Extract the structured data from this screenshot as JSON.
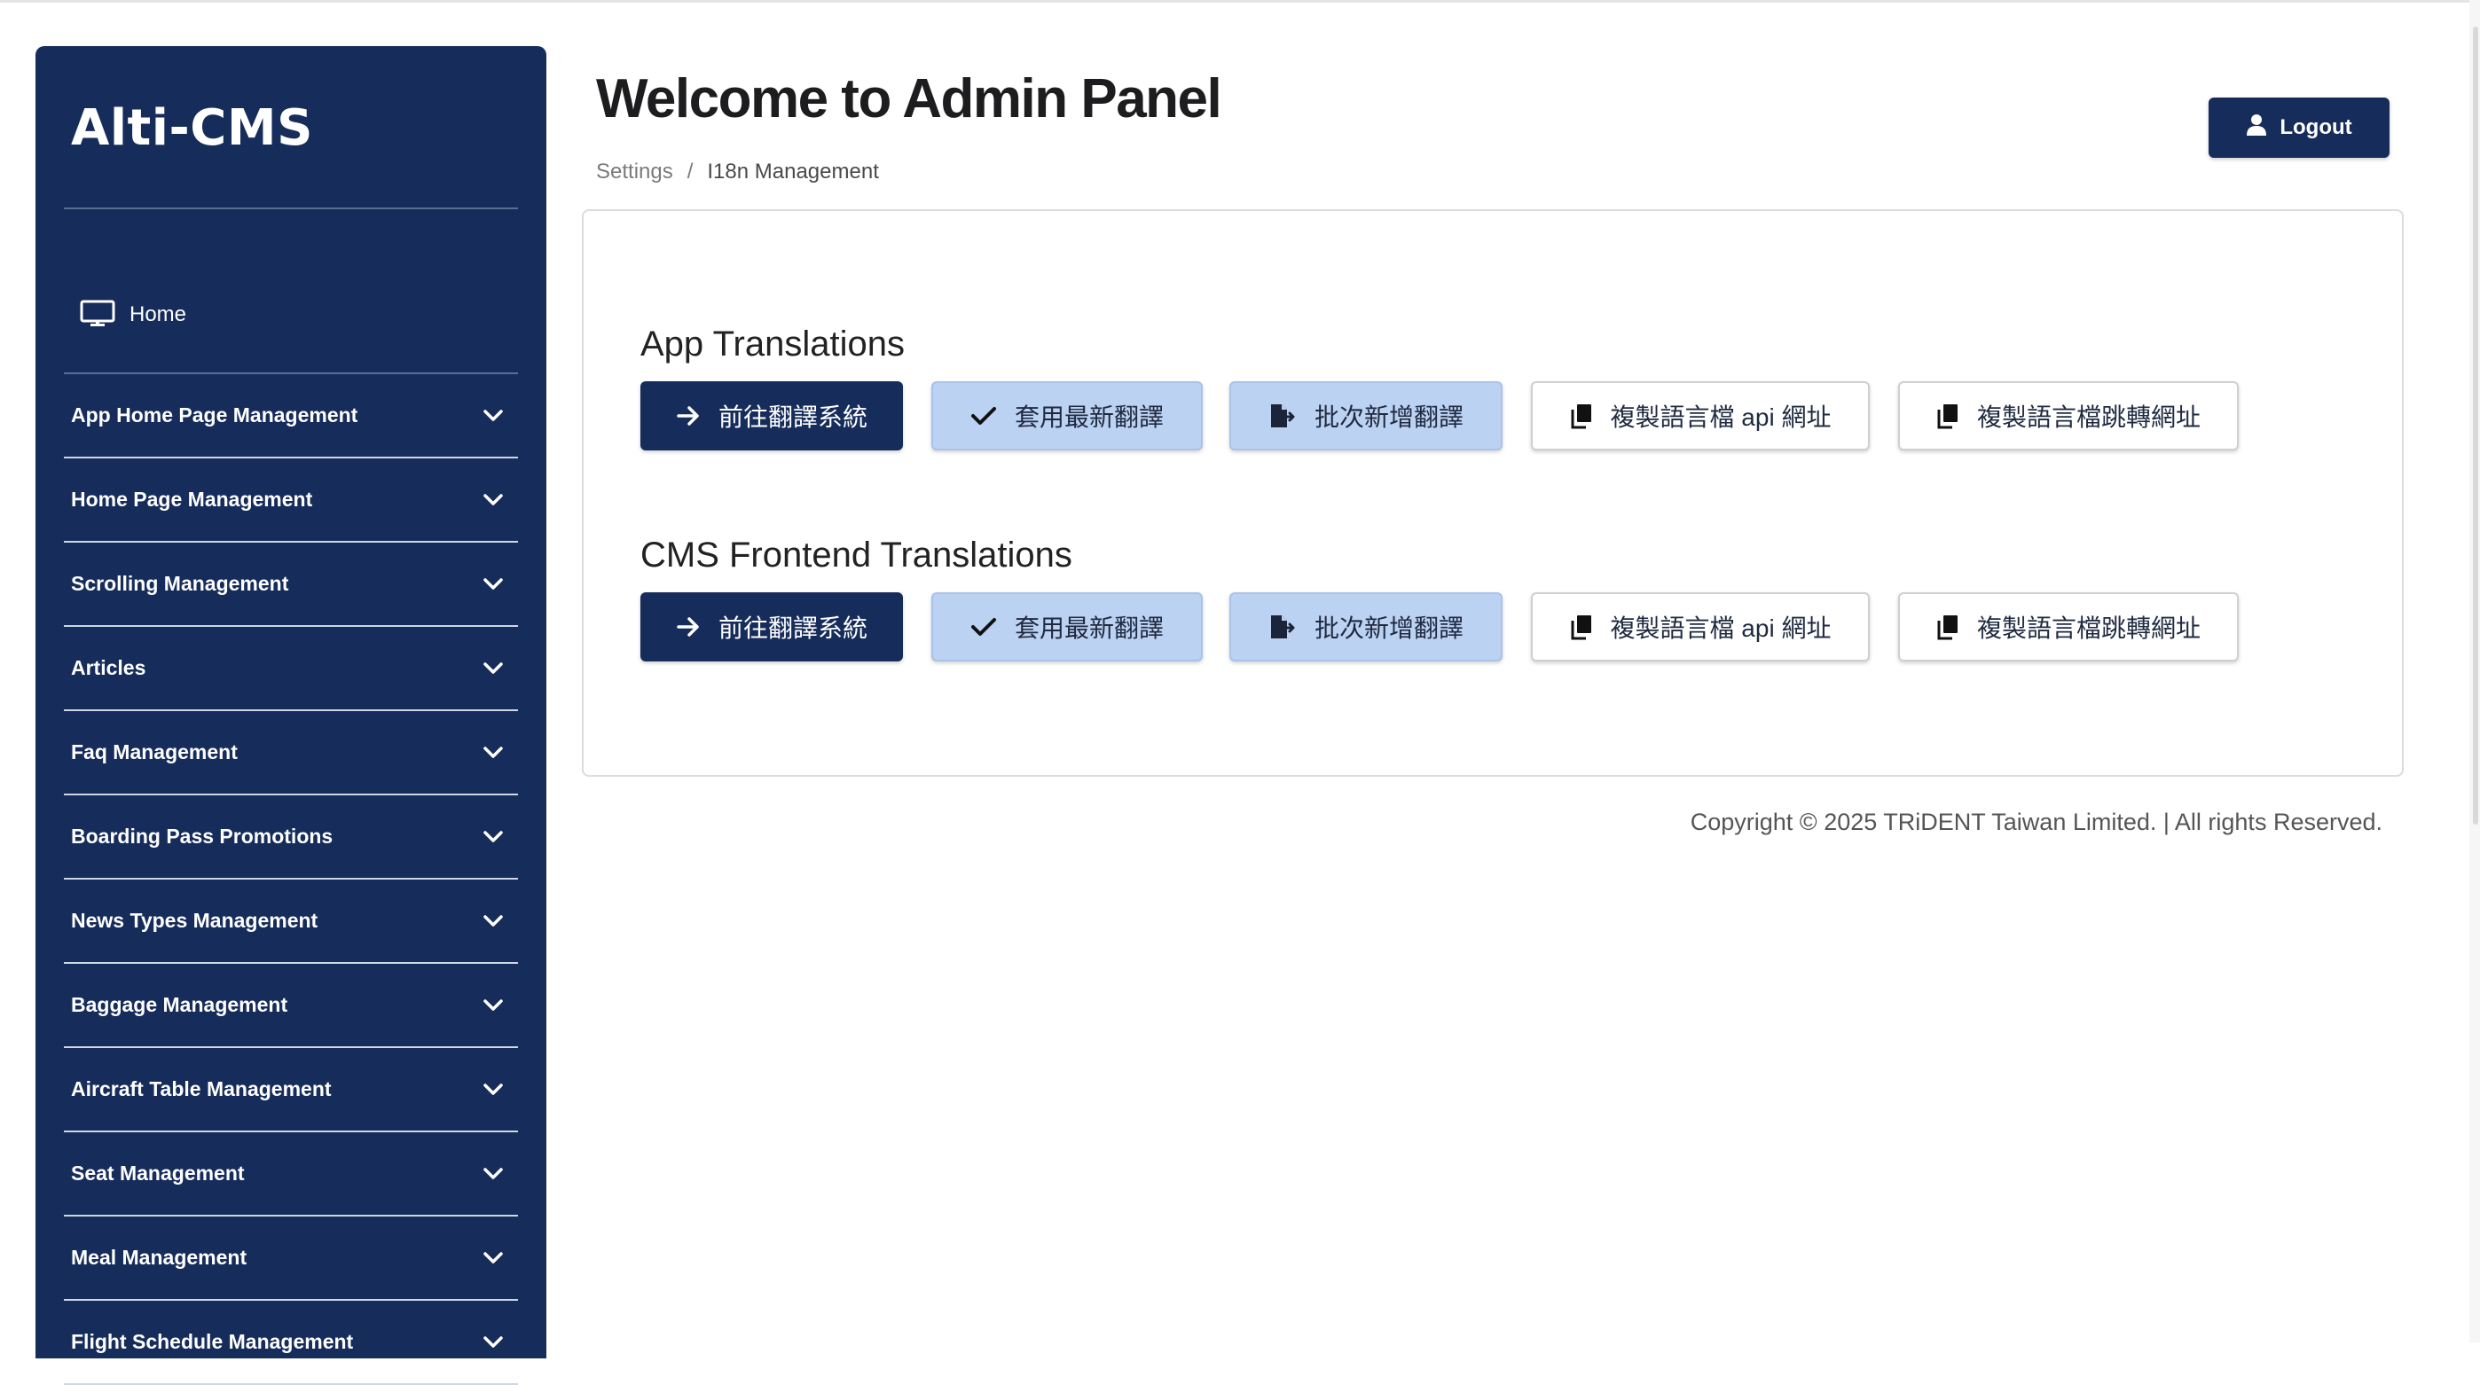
{
  "sidebar": {
    "brand": "Alti-CMS",
    "home": {
      "label": "Home",
      "icon": "monitor-icon"
    },
    "items": [
      {
        "label": "App Home Page Management"
      },
      {
        "label": "Home Page Management"
      },
      {
        "label": "Scrolling Management"
      },
      {
        "label": "Articles"
      },
      {
        "label": "Faq Management"
      },
      {
        "label": "Boarding Pass Promotions"
      },
      {
        "label": "News Types Management"
      },
      {
        "label": "Baggage Management"
      },
      {
        "label": "Aircraft Table Management"
      },
      {
        "label": "Seat Management"
      },
      {
        "label": "Meal Management"
      },
      {
        "label": "Flight Schedule Management"
      }
    ]
  },
  "header": {
    "title": "Welcome to Admin Panel",
    "breadcrumb": {
      "parent": "Settings",
      "separator": "/",
      "current": "I18n Management"
    },
    "logout_label": "Logout"
  },
  "sections": [
    {
      "title": "App Translations",
      "buttons": {
        "goto": "前往翻譯系統",
        "apply": "套用最新翻譯",
        "batch_add": "批次新增翻譯",
        "copy_api": "複製語言檔 api 網址",
        "copy_redirect": "複製語言檔跳轉網址"
      }
    },
    {
      "title": "CMS Frontend Translations",
      "buttons": {
        "goto": "前往翻譯系統",
        "apply": "套用最新翻譯",
        "batch_add": "批次新增翻譯",
        "copy_api": "複製語言檔 api 網址",
        "copy_redirect": "複製語言檔跳轉網址"
      }
    }
  ],
  "footer": {
    "copyright": "Copyright © 2025 TRiDENT Taiwan Limited. | All rights Reserved."
  },
  "colors": {
    "sidebar_bg": "#162c5b",
    "primary": "#162c5b",
    "light_button": "#bcd2f3"
  }
}
